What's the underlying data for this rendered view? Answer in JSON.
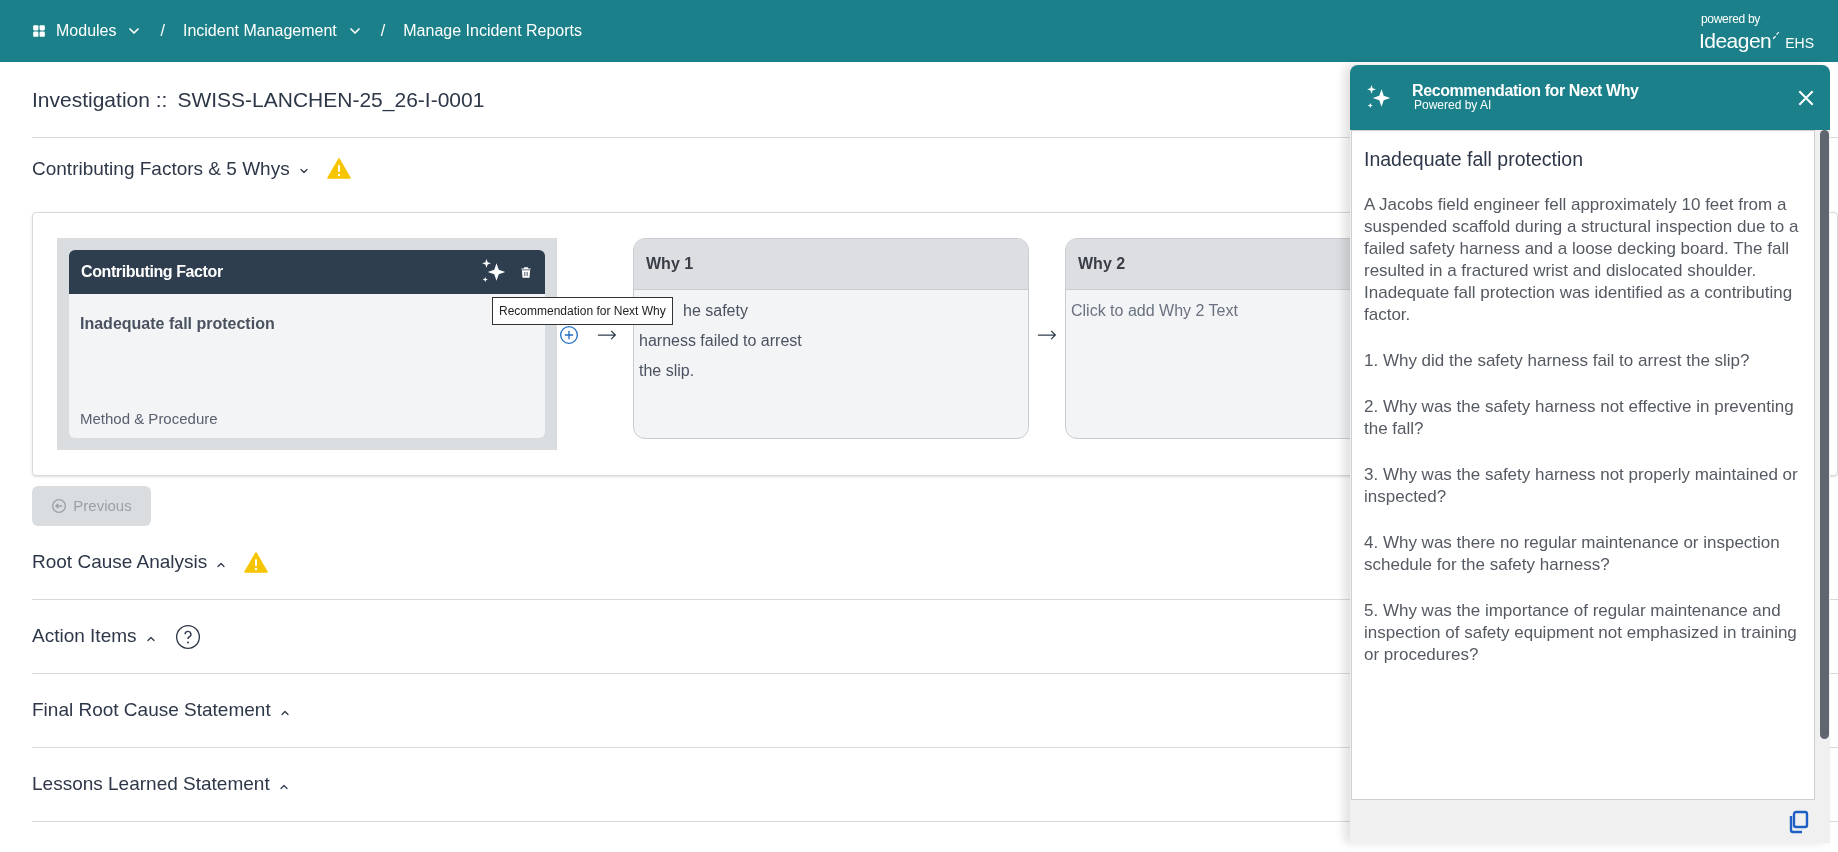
{
  "breadcrumb": [
    {
      "kind": "link",
      "label": "Modules",
      "dropdown": true,
      "icon": true
    },
    {
      "kind": "separator",
      "label": "/"
    },
    {
      "kind": "link",
      "label": "Incident Management",
      "dropdown": true
    },
    {
      "kind": "separator",
      "label": "/"
    },
    {
      "kind": "link",
      "label": "Manage Incident Reports",
      "dropdown": false
    }
  ],
  "brand": {
    "powered_by": "powered by",
    "name": "Ideagen",
    "suffix": "EHS"
  },
  "page_title": {
    "label": "Investigation ::",
    "id": "SWISS-LANCHEN-25_26-I-0001"
  },
  "sections": [
    {
      "title": "Contributing Factors & 5 Whys",
      "expanded": true,
      "warning": true,
      "help": false
    },
    {
      "title": "Root Cause Analysis",
      "expanded": false,
      "warning": true,
      "help": false
    },
    {
      "title": "Action Items",
      "expanded": false,
      "warning": false,
      "help": true
    },
    {
      "title": "Final Root Cause Statement",
      "expanded": false,
      "warning": false,
      "help": false
    },
    {
      "title": "Lessons Learned Statement",
      "expanded": false,
      "warning": false,
      "help": false
    }
  ],
  "contributing_factor": {
    "header": "Contributing Factor",
    "text": "Inadequate fall protection",
    "category": "Method & Procedure"
  },
  "whys": [
    {
      "title": "Why 1",
      "empty": false,
      "lines": [
        "he safety",
        "harness failed to arrest",
        "the slip."
      ]
    },
    {
      "title": "Why 2",
      "empty": true,
      "lines": [
        "Click to add Why 2 Text"
      ]
    }
  ],
  "tooltip": "Recommendation for Next Why",
  "previous_button": {
    "label": "Previous",
    "disabled": true
  },
  "panel": {
    "title": "Recommendation for Next Why",
    "subtitle": "Powered by AI",
    "heading": "Inadequate fall protection",
    "paragraphs": [
      "A Jacobs field engineer fell approximately 10 feet from a suspended scaffold during a structural inspection due to a failed safety harness and a loose decking board. The fall resulted in a fractured wrist and dislocated shoulder. Inadequate fall protection was identified as a contributing factor.",
      "1. Why did the safety harness fail to arrest the slip?",
      "2. Why was the safety harness not effective in preventing the fall?",
      "3. Why was the safety harness not properly maintained or inspected?",
      "4. Why was there no regular maintenance or inspection schedule for the safety harness?",
      "5. Why was the importance of regular maintenance and inspection of safety equipment not emphasized in training or procedures?"
    ]
  }
}
